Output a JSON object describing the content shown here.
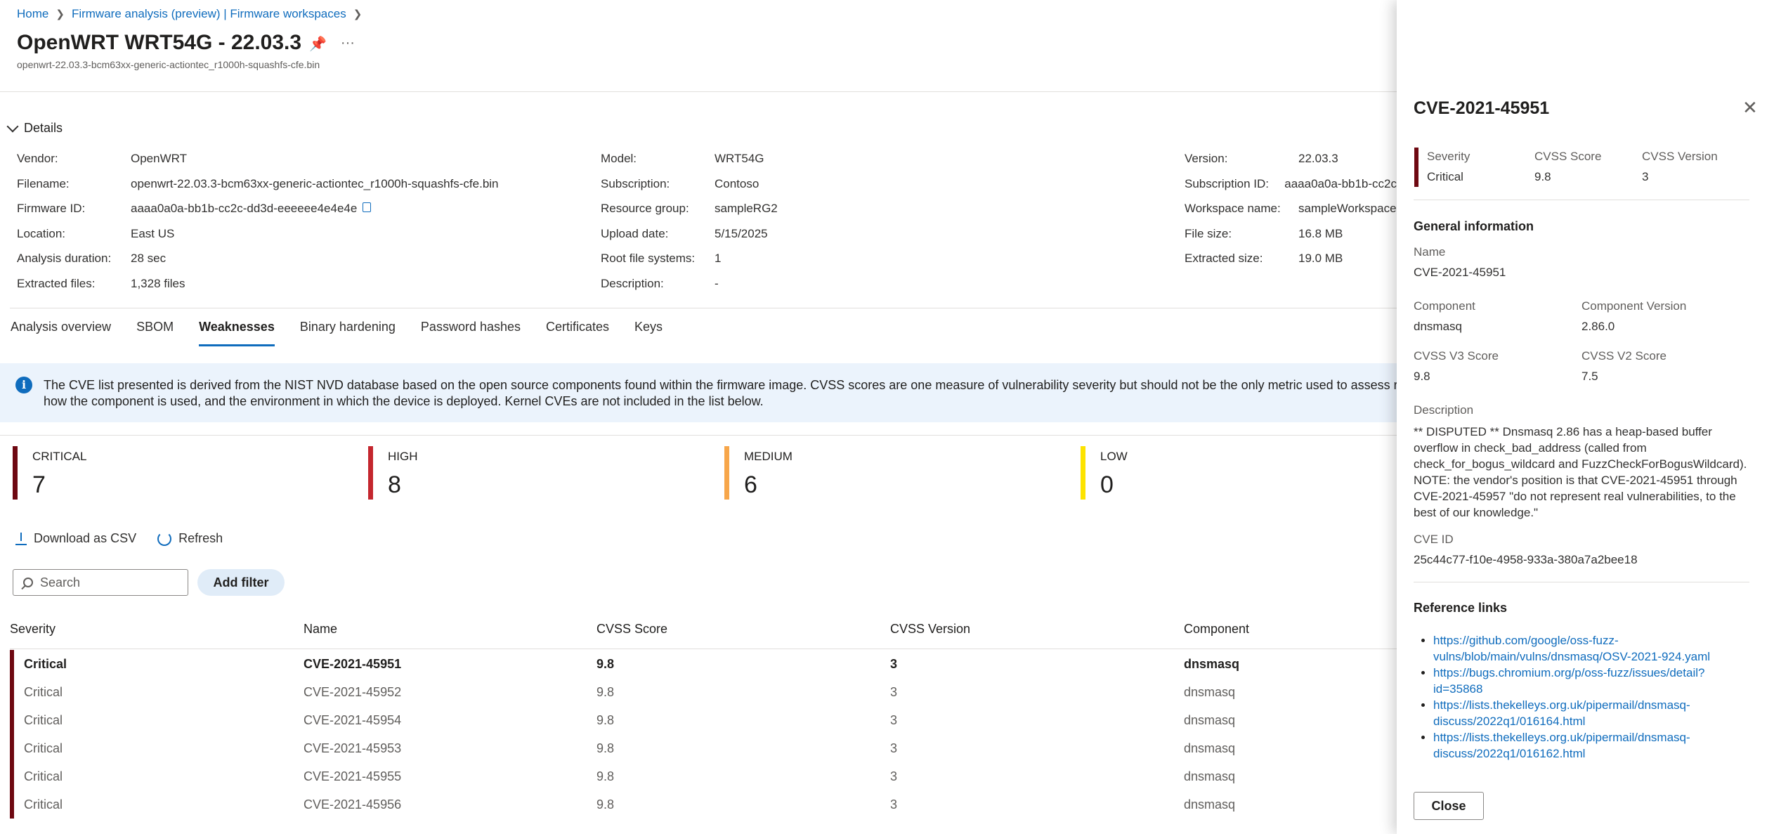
{
  "breadcrumb": [
    {
      "label": "Home"
    },
    {
      "label": "Firmware analysis (preview) | Firmware workspaces"
    }
  ],
  "header": {
    "title": "OpenWRT WRT54G - 22.03.3",
    "subtitle": "openwrt-22.03.3-bcm63xx-generic-actiontec_r1000h-squashfs-cfe.bin",
    "pin_icon": "pin-icon",
    "more_icon": "ellipsis-icon",
    "close_glyph": "✕"
  },
  "details": {
    "toggle_label": "Details",
    "col1": [
      {
        "key": "Vendor:",
        "value": "OpenWRT"
      },
      {
        "key": "Filename:",
        "value": "openwrt-22.03.3-bcm63xx-generic-actiontec_r1000h-squashfs-cfe.bin"
      },
      {
        "key": "Firmware ID:",
        "value": "aaaa0a0a-bb1b-cc2c-dd3d-eeeeee4e4e4e"
      },
      {
        "key": "Location:",
        "value": "East US"
      },
      {
        "key": "Analysis duration:",
        "value": "28 sec"
      },
      {
        "key": "Extracted files:",
        "value": "1,328 files"
      }
    ],
    "col2": [
      {
        "key": "Model:",
        "value": "WRT54G"
      },
      {
        "key": "Subscription:",
        "value": "Contoso"
      },
      {
        "key": "Resource group:",
        "value": "sampleRG2"
      },
      {
        "key": "Upload date:",
        "value": "5/15/2025"
      },
      {
        "key": "Root file systems:",
        "value": "1"
      },
      {
        "key": "Description:",
        "value": "-"
      }
    ],
    "col3": [
      {
        "key": "Version:",
        "value": "22.03.3"
      },
      {
        "key": "Subscription ID:",
        "value": "aaaa0a0a-bb1b-cc2c"
      },
      {
        "key": "Workspace name:",
        "value": "sampleWorkspace"
      },
      {
        "key": "File size:",
        "value": "16.8 MB"
      },
      {
        "key": "Extracted size:",
        "value": "19.0 MB"
      }
    ]
  },
  "tabs": [
    {
      "label": "Analysis overview",
      "active": false
    },
    {
      "label": "SBOM",
      "active": false
    },
    {
      "label": "Weaknesses",
      "active": true
    },
    {
      "label": "Binary hardening",
      "active": false
    },
    {
      "label": "Password hashes",
      "active": false
    },
    {
      "label": "Certificates",
      "active": false
    },
    {
      "label": "Keys",
      "active": false
    }
  ],
  "banner": {
    "icon": "info-icon",
    "line1": "The CVE list presented is derived from the NIST NVD database based on the open source components found within the firmware image. CVSS scores are one measure of vulnerability severity but should not be the only metric used to assess risk. Actua",
    "line2": "how the component is used, and the environment in which the device is deployed. Kernel CVEs are not included in the list below."
  },
  "severity_cards": [
    {
      "label": "CRITICAL",
      "count": "7",
      "color": "#6e0811"
    },
    {
      "label": "HIGH",
      "count": "8",
      "color": "#c4262e"
    },
    {
      "label": "MEDIUM",
      "count": "6",
      "color": "#f7a64a"
    },
    {
      "label": "LOW",
      "count": "0",
      "color": "#fde300"
    }
  ],
  "toolbar": {
    "download_label": "Download as CSV",
    "refresh_label": "Refresh"
  },
  "search": {
    "placeholder": "Search"
  },
  "add_filter_label": "Add filter",
  "table": {
    "headers": [
      "Severity",
      "Name",
      "CVSS Score",
      "CVSS Version",
      "Component"
    ],
    "rows": [
      {
        "severity": "Critical",
        "name": "CVE-2021-45951",
        "score": "9.8",
        "version": "3",
        "component": "dnsmasq",
        "selected": true
      },
      {
        "severity": "Critical",
        "name": "CVE-2021-45952",
        "score": "9.8",
        "version": "3",
        "component": "dnsmasq",
        "selected": false
      },
      {
        "severity": "Critical",
        "name": "CVE-2021-45954",
        "score": "9.8",
        "version": "3",
        "component": "dnsmasq",
        "selected": false
      },
      {
        "severity": "Critical",
        "name": "CVE-2021-45953",
        "score": "9.8",
        "version": "3",
        "component": "dnsmasq",
        "selected": false
      },
      {
        "severity": "Critical",
        "name": "CVE-2021-45955",
        "score": "9.8",
        "version": "3",
        "component": "dnsmasq",
        "selected": false
      },
      {
        "severity": "Critical",
        "name": "CVE-2021-45956",
        "score": "9.8",
        "version": "3",
        "component": "dnsmasq",
        "selected": false
      }
    ]
  },
  "panel": {
    "title": "CVE-2021-45951",
    "severity_label": "Severity",
    "severity_value": "Critical",
    "cvss_score_label": "CVSS Score",
    "cvss_score_value": "9.8",
    "cvss_version_label": "CVSS Version",
    "cvss_version_value": "3",
    "general_heading": "General information",
    "name_label": "Name",
    "name_value": "CVE-2021-45951",
    "component_label": "Component",
    "component_value": "dnsmasq",
    "component_version_label": "Component Version",
    "component_version_value": "2.86.0",
    "v3_label": "CVSS V3 Score",
    "v3_value": "9.8",
    "v2_label": "CVSS V2 Score",
    "v2_value": "7.5",
    "description_label": "Description",
    "description_lines": [
      "** DISPUTED ** Dnsmasq 2.86 has a heap-based buffer",
      "overflow in check_bad_address (called from",
      "check_for_bogus_wildcard and FuzzCheckForBogusWildcard).",
      "NOTE: the vendor's position is that CVE-2021-45951 through",
      "CVE-2021-45957 \"do not represent real vulnerabilities, to the",
      "best of our knowledge.\""
    ],
    "cve_id_label": "CVE ID",
    "cve_id_value": "25c44c77-f10e-4958-933a-380a7a2bee18",
    "reference_heading": "Reference links",
    "links": [
      {
        "line1": "https://github.com/google/oss-fuzz-",
        "line2": "vulns/blob/main/vulns/dnsmasq/OSV-2021-924.yaml"
      },
      {
        "line1": "https://bugs.chromium.org/p/oss-fuzz/issues/detail?",
        "line2": "id=35868"
      },
      {
        "line1": "https://lists.thekelleys.org.uk/pipermail/dnsmasq-",
        "line2": "discuss/2022q1/016164.html"
      },
      {
        "line1": "https://lists.thekelleys.org.uk/pipermail/dnsmasq-",
        "line2": "discuss/2022q1/016162.html"
      }
    ],
    "close_button_label": "Close",
    "close_glyph": "✕"
  }
}
